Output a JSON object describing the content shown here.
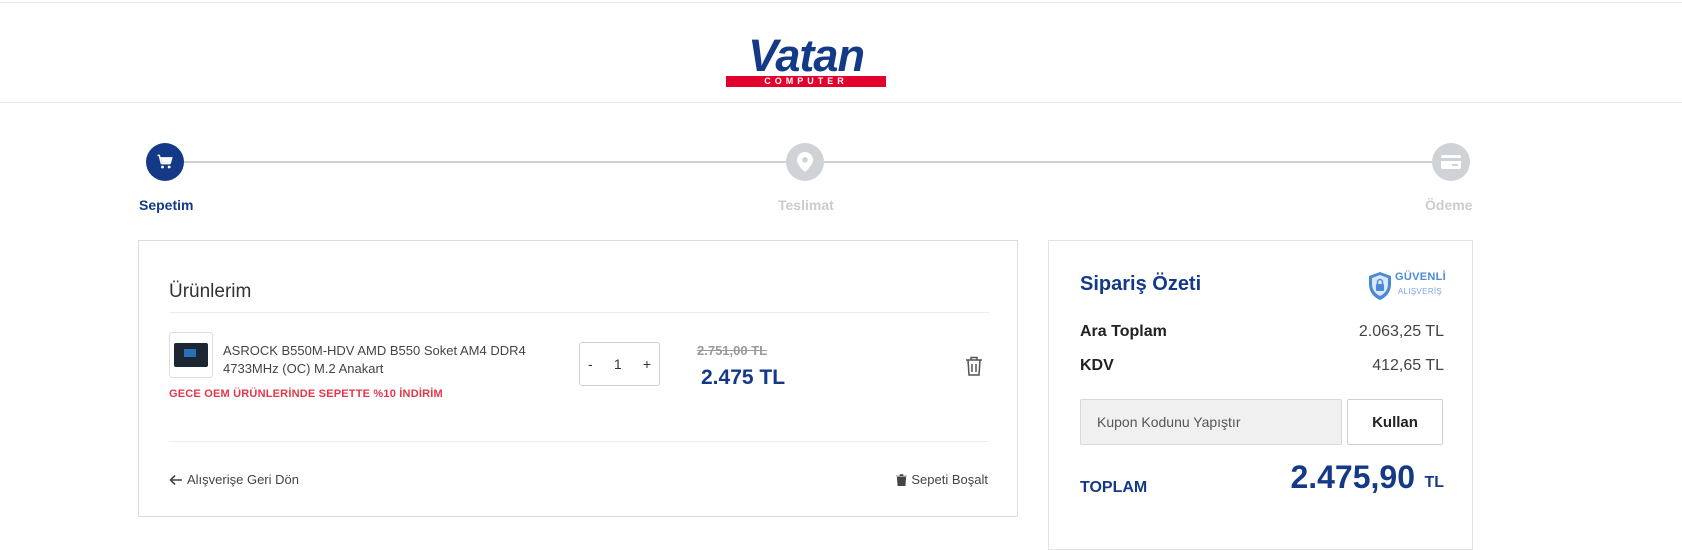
{
  "logo": {
    "word": "Vatan",
    "sub": "COMPUTER"
  },
  "steps": [
    {
      "label": "Sepetim",
      "icon": "cart-icon",
      "state": "active"
    },
    {
      "label": "Teslimat",
      "icon": "location-pin-icon",
      "state": "inactive"
    },
    {
      "label": "Ödeme",
      "icon": "credit-card-icon",
      "state": "inactive"
    }
  ],
  "cart": {
    "title": "Ürünlerim",
    "product": {
      "name": "ASROCK B550M-HDV AMD B550 Soket AM4 DDR4 4733MHz (OC) M.2 Anakart",
      "promo": "GECE OEM ÜRÜNLERİNDE SEPETTE %10 İNDİRİM",
      "qty_minus": "-",
      "quantity": "1",
      "qty_plus": "+",
      "old_price": "2.751,00 TL",
      "new_price": "2.475 TL"
    },
    "back_link": "Alışverişe Geri Dön",
    "empty_cart": "Sepeti Boşalt"
  },
  "summary": {
    "title": "Sipariş Özeti",
    "secure_badge": {
      "line1": "GÜVENLİ",
      "line2": "ALIŞVERİŞ"
    },
    "subtotal_label": "Ara Toplam",
    "subtotal_value": "2.063,25 TL",
    "tax_label": "KDV",
    "tax_value": "412,65 TL",
    "coupon_placeholder": "Kupon Kodunu Yapıştır",
    "apply_button": "Kullan",
    "total_label": "TOPLAM",
    "total_value": "2.475,90",
    "total_currency": "TL"
  },
  "colors": {
    "brand": "#143a87",
    "accent": "#e2002d",
    "promo": "#e2374b",
    "inactive": "#cfd2d6"
  }
}
